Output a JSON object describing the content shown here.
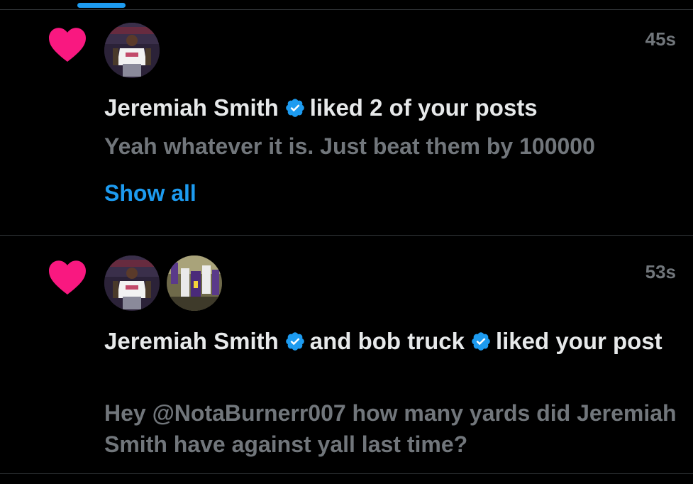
{
  "colors": {
    "accent": "#1d9bf0",
    "like_pink": "#f91880",
    "verified_blue": "#1d9bf0",
    "muted_text": "#71767b",
    "primary_text": "#e7e9ea",
    "background": "#000000",
    "divider": "#2f3336"
  },
  "icons": {
    "like": "heart-icon",
    "verified": "verified-badge-icon"
  },
  "notifications": [
    {
      "timestamp": "45s",
      "user1": "Jeremiah Smith",
      "action": "liked 2 of your posts",
      "snippet": "Yeah whatever it is. Just beat them by 100000",
      "show_all": "Show all"
    },
    {
      "timestamp": "53s",
      "user1": "Jeremiah Smith",
      "connector": "and",
      "user2": "bob truck",
      "action": "liked your post",
      "snippet": "Hey @NotaBurnerr007 how many yards did Jeremiah Smith have against yall last time?"
    }
  ]
}
